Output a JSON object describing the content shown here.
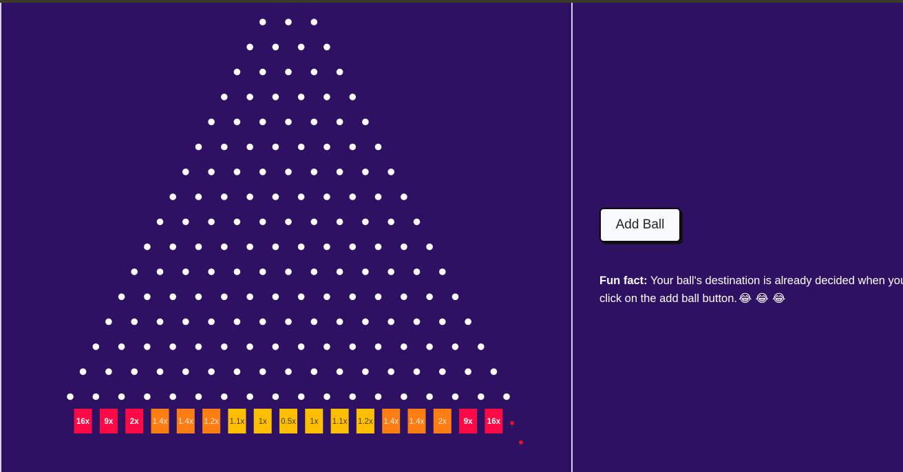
{
  "game": {
    "peg_rows": 16,
    "multipliers": [
      {
        "label": "16x",
        "color": "#ff0a45"
      },
      {
        "label": "9x",
        "color": "#ff0a45"
      },
      {
        "label": "2x",
        "color": "#ff0a45"
      },
      {
        "label": "1.4x",
        "color": "#ff7e14"
      },
      {
        "label": "1.4x",
        "color": "#ff7e14"
      },
      {
        "label": "1.2x",
        "color": "#ff7e14"
      },
      {
        "label": "1.1x",
        "color": "#ffbf00"
      },
      {
        "label": "1x",
        "color": "#ffbf00"
      },
      {
        "label": "0.5x",
        "color": "#ffbf00"
      },
      {
        "label": "1x",
        "color": "#ffbf00"
      },
      {
        "label": "1.1x",
        "color": "#ffbf00"
      },
      {
        "label": "1.2x",
        "color": "#ffbf00"
      },
      {
        "label": "1.4x",
        "color": "#ff7e14"
      },
      {
        "label": "1.4x",
        "color": "#ff7e14"
      },
      {
        "label": "2x",
        "color": "#ff7e14"
      },
      {
        "label": "9x",
        "color": "#ff0a45"
      },
      {
        "label": "16x",
        "color": "#ff0a45"
      }
    ],
    "ball_color": "#e0132b",
    "peg_color": "#ffffff",
    "background": "#2e1163"
  },
  "controls": {
    "add_ball_label": "Add Ball"
  },
  "fun_fact": {
    "heading": "Fun fact:",
    "text": " Your ball's destination is already decided when you click on the add ball button.",
    "emoji": "😂 😂 😂"
  }
}
